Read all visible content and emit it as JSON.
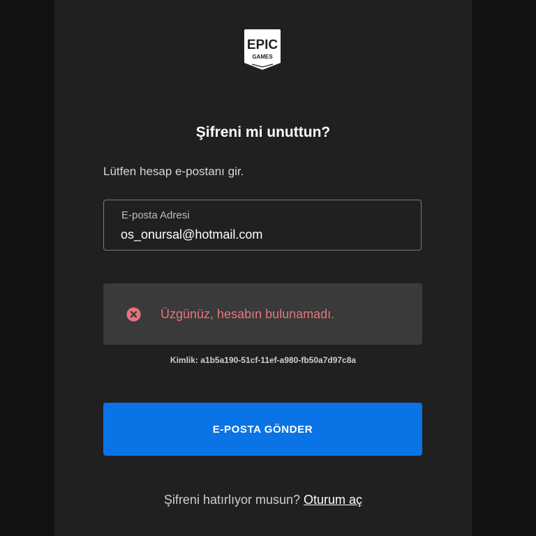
{
  "logo": {
    "line1": "EPIC",
    "line2": "GAMES"
  },
  "title": "Şifreni mi unuttun?",
  "subtitle": "Lütfen hesap e-postanı gir.",
  "email_field": {
    "label": "E-posta Adresi",
    "value": "os_onursal@hotmail.com"
  },
  "error": {
    "icon": "error-x-circle-icon",
    "message": "Üzgünüz, hesabın bulunamadı."
  },
  "kimlik": "Kimlik: a1b5a190-51cf-11ef-a980-fb50a7d97c8a",
  "submit_button": {
    "label": "E-POSTA GÖNDER"
  },
  "footer": {
    "question": "Şifreni hatırlıyor musun?",
    "link_label": "Oturum aç"
  },
  "colors": {
    "background": "#121212",
    "card": "#202020",
    "accent": "#0a74e6",
    "error_text": "#e8747c",
    "error_bg": "#3a3a3a"
  }
}
